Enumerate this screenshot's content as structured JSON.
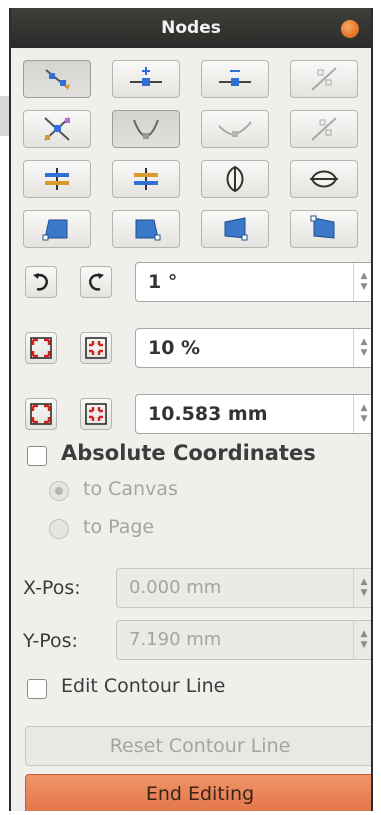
{
  "window": {
    "title": "Nodes"
  },
  "toolbar": {
    "rows": [
      [
        "Move Nodes",
        "Insert Nodes",
        "Delete Nodes",
        "Split Path"
      ],
      [
        "Reset Control Points",
        "Symmetric Bezier",
        "Asymmetric Bezier",
        "Connect Nodes"
      ],
      [
        "Flip Horizontal",
        "Flip Vertical",
        "Rotate",
        "Shear"
      ],
      [
        "Perspective 1",
        "Perspective 2",
        "Perspective 3",
        "Perspective 4"
      ]
    ]
  },
  "rotate": {
    "value": "1 °"
  },
  "scale_percent": {
    "value": "10 %"
  },
  "scale_length": {
    "value": "10.583 mm"
  },
  "absolute": {
    "label": "Absolute Coordinates",
    "checked": false,
    "options": [
      {
        "label": "to Canvas",
        "selected": true,
        "enabled": false
      },
      {
        "label": "to Page",
        "selected": false,
        "enabled": false
      }
    ]
  },
  "xpos": {
    "label": "X-Pos:",
    "value": "0.000 mm"
  },
  "ypos": {
    "label": "Y-Pos:",
    "value": "7.190 mm"
  },
  "contour": {
    "label": "Edit Contour Line",
    "checked": false
  },
  "buttons": {
    "reset": "Reset Contour Line",
    "end": "End Editing"
  },
  "colors": {
    "accent": "#e97e51",
    "title_bg": "#2f2f2d",
    "close": "#e7772b"
  }
}
